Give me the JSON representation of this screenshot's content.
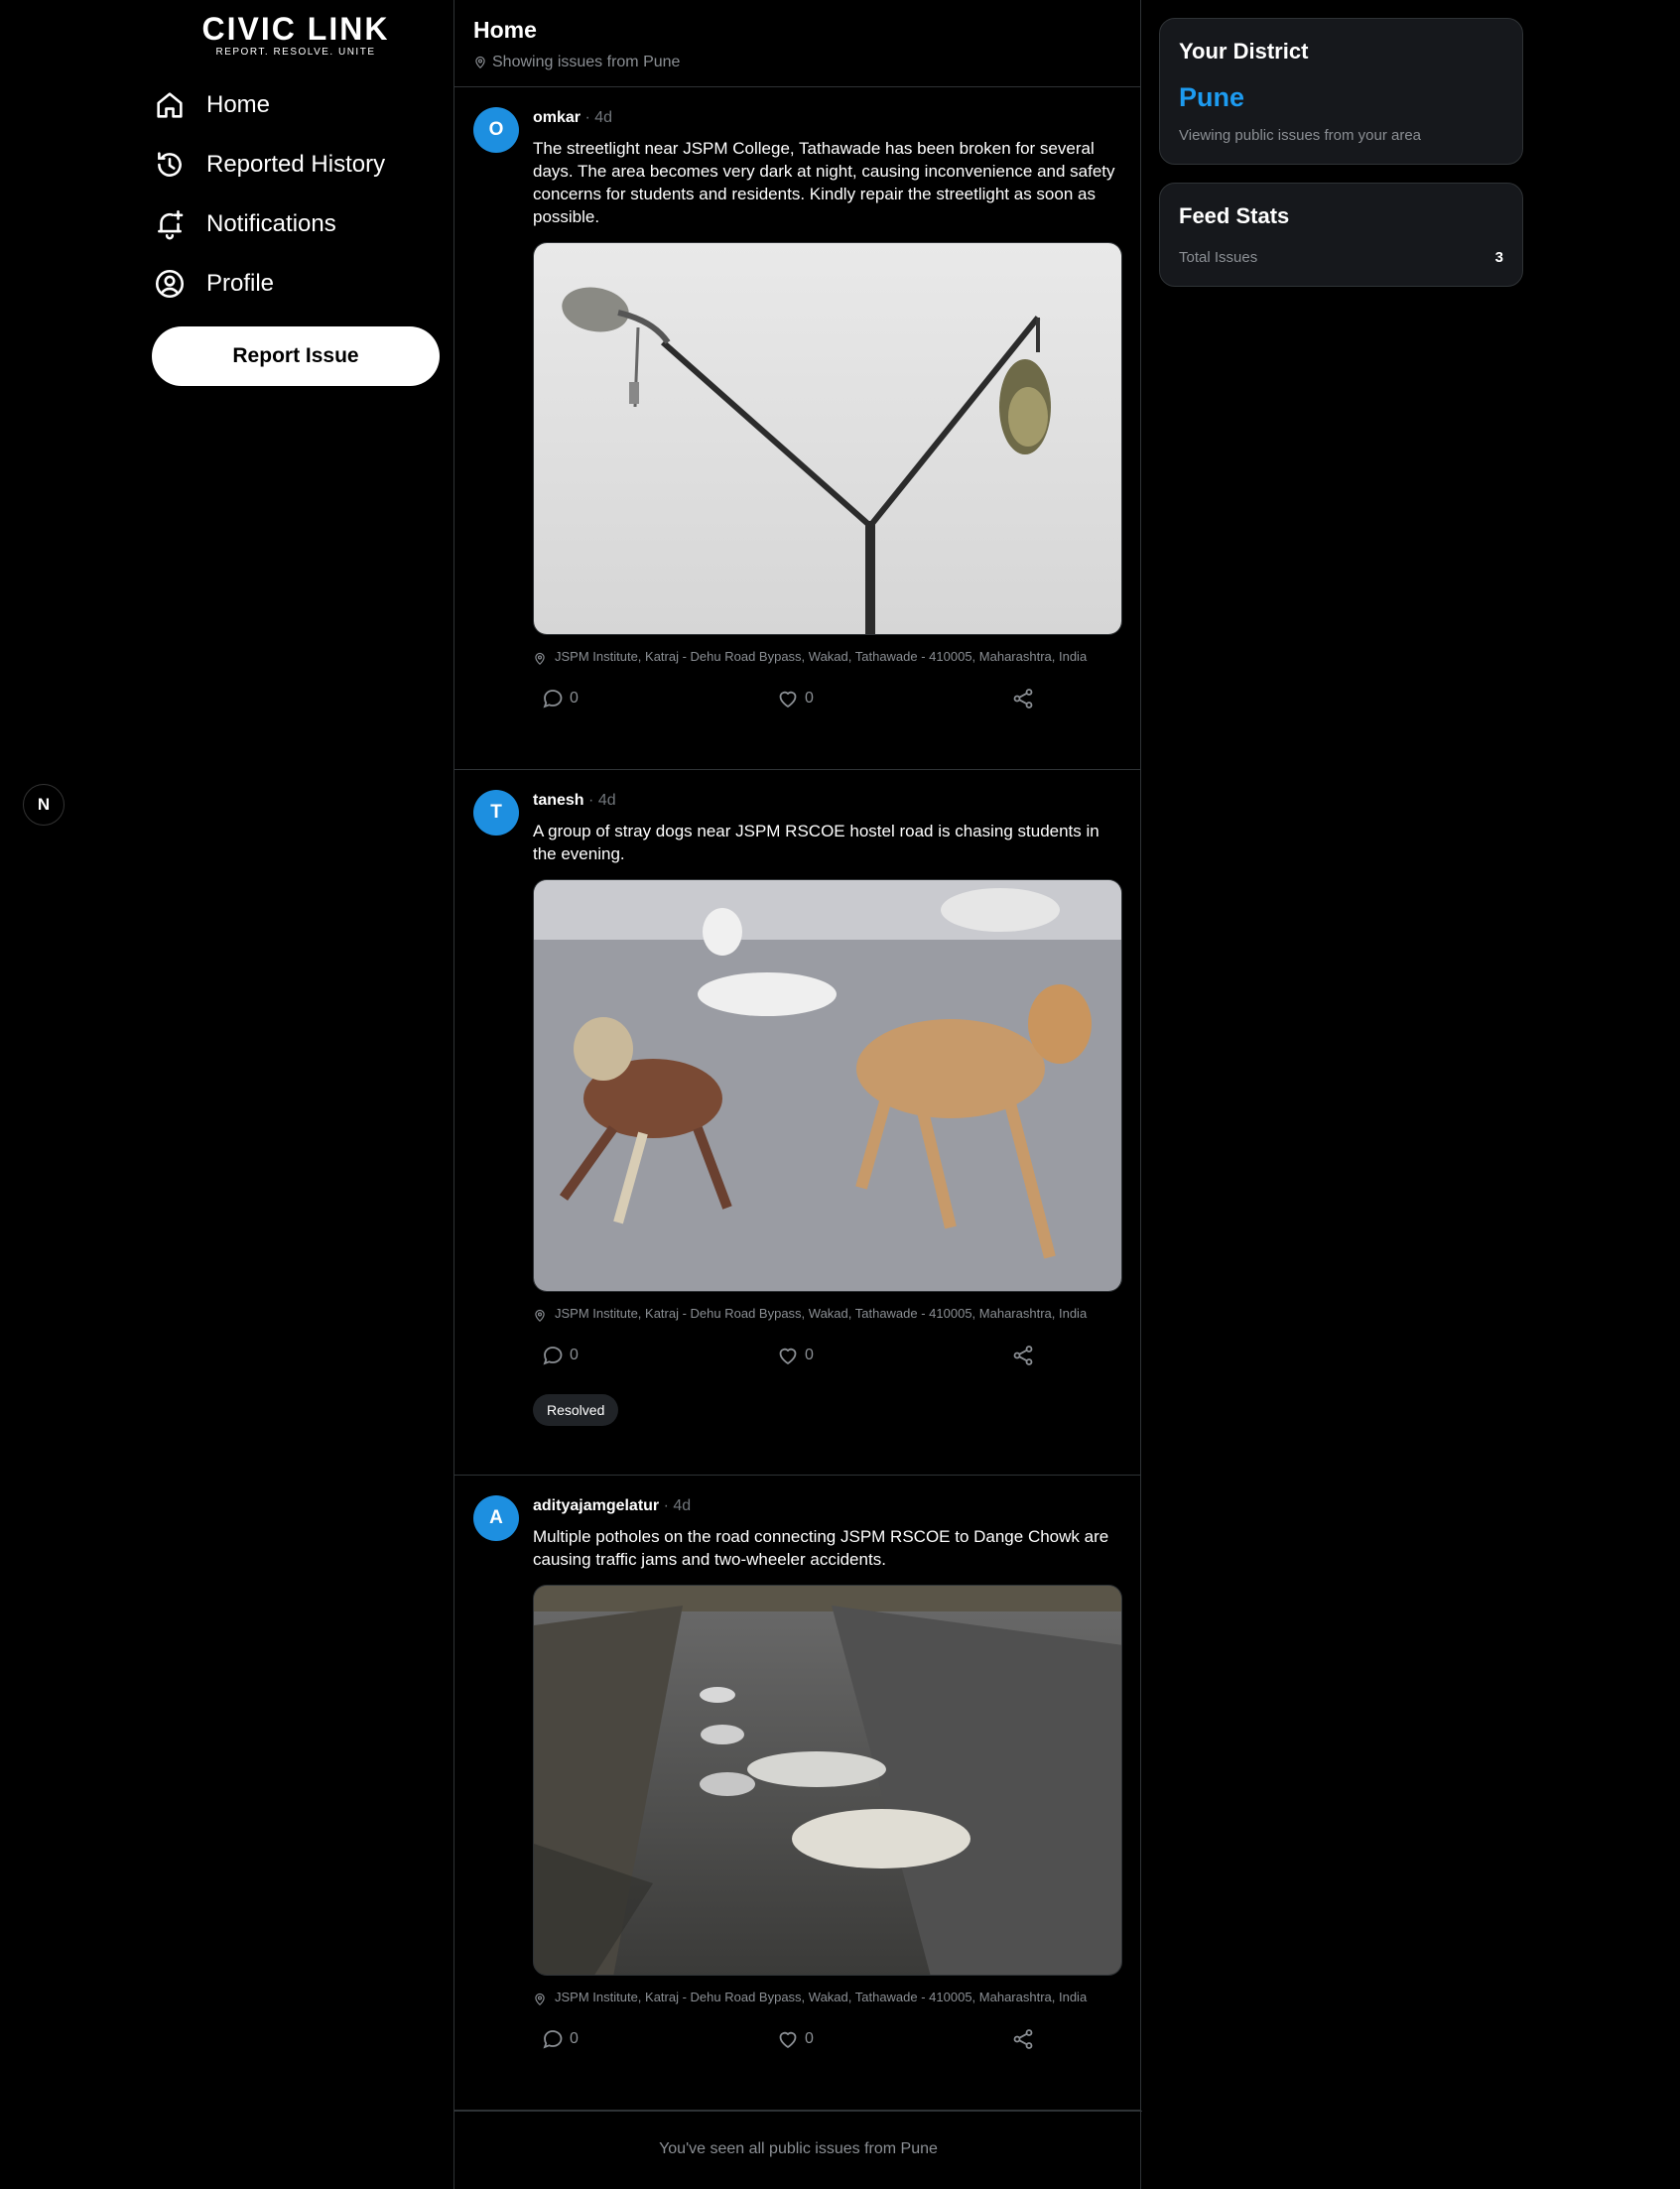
{
  "brand": {
    "name": "CIVIC LINK",
    "tagline": "REPORT. RESOLVE. UNITE"
  },
  "nav": [
    {
      "label": "Home",
      "icon": "home-icon"
    },
    {
      "label": "Reported History",
      "icon": "history-icon"
    },
    {
      "label": "Notifications",
      "icon": "bell-plus-icon"
    },
    {
      "label": "Profile",
      "icon": "user-circle-icon"
    }
  ],
  "report_button": "Report Issue",
  "next_badge": "N",
  "feed": {
    "title": "Home",
    "subtitle": "Showing issues from Pune",
    "posts": [
      {
        "initial": "O",
        "user": "omkar",
        "sep": "·",
        "time": "4d",
        "text": "The streetlight near JSPM College, Tathawade has been broken for several days. The area becomes very dark at night, causing inconvenience and safety concerns for students and residents. Kindly repair the streetlight as soon as possible.",
        "image": "broken-streetlight-photo",
        "location": "JSPM Institute, Katraj - Dehu Road Bypass, Wakad, Tathawade - 410005, Maharashtra, India",
        "comments": "0",
        "likes": "0"
      },
      {
        "initial": "T",
        "user": "tanesh",
        "sep": "·",
        "time": "4d",
        "text": "A group of stray dogs near JSPM RSCOE hostel road is chasing students in the evening.",
        "image": "stray-dogs-photo",
        "location": "JSPM Institute, Katraj - Dehu Road Bypass, Wakad, Tathawade - 410005, Maharashtra, India",
        "comments": "0",
        "likes": "0",
        "status": "Resolved"
      },
      {
        "initial": "A",
        "user": "adityajamgelatur",
        "sep": "·",
        "time": "4d",
        "text": "Multiple potholes on the road connecting JSPM RSCOE to Dange Chowk are causing traffic jams and two-wheeler accidents.",
        "image": "potholes-road-photo",
        "location": "JSPM Institute, Katraj - Dehu Road Bypass, Wakad, Tathawade - 410005, Maharashtra, India",
        "comments": "0",
        "likes": "0"
      }
    ],
    "end_message": "You've seen all public issues from Pune"
  },
  "district": {
    "title": "Your District",
    "name": "Pune",
    "subtitle": "Viewing public issues from your area"
  },
  "stats": {
    "title": "Feed Stats",
    "total_label": "Total Issues",
    "total_value": "3"
  },
  "colors": {
    "accent": "#1d9bf0",
    "avatar": "#1d8fe0",
    "background": "#000000",
    "card": "#16181c"
  }
}
